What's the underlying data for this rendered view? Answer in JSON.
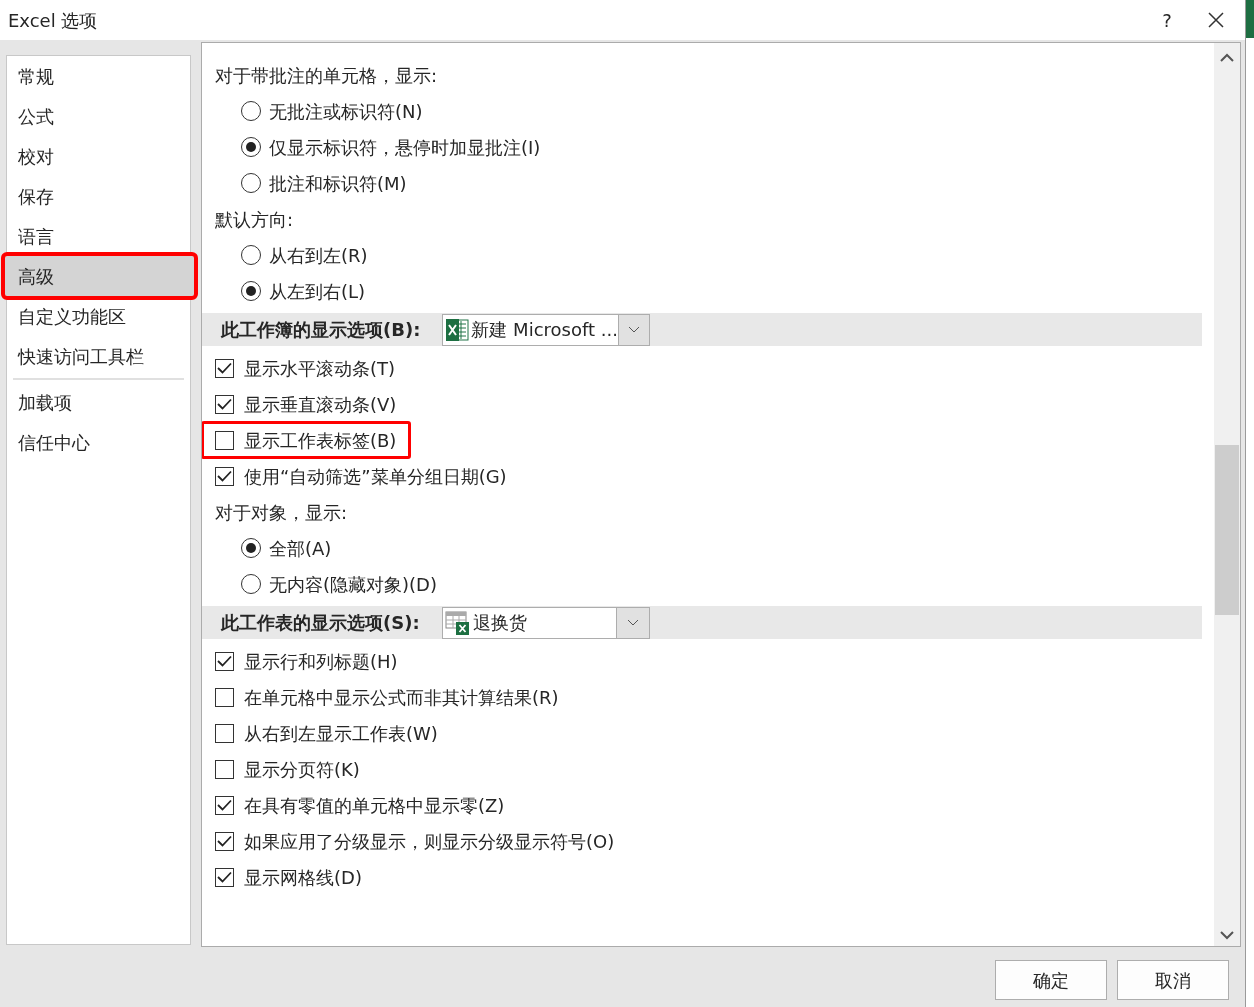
{
  "window": {
    "title": "Excel 选项",
    "help": "?"
  },
  "sidebar": {
    "groups": [
      [
        {
          "label": "常规",
          "selected": false,
          "highlighted": false
        },
        {
          "label": "公式",
          "selected": false,
          "highlighted": false
        },
        {
          "label": "校对",
          "selected": false,
          "highlighted": false
        },
        {
          "label": "保存",
          "selected": false,
          "highlighted": false
        },
        {
          "label": "语言",
          "selected": false,
          "highlighted": false
        },
        {
          "label": "高级",
          "selected": true,
          "highlighted": true
        },
        {
          "label": "自定义功能区",
          "selected": false,
          "highlighted": false
        },
        {
          "label": "快速访问工具栏",
          "selected": false,
          "highlighted": false
        }
      ],
      [
        {
          "label": "加载项",
          "selected": false,
          "highlighted": false
        },
        {
          "label": "信任中心",
          "selected": false,
          "highlighted": false
        }
      ]
    ]
  },
  "content": {
    "items": [
      {
        "kind": "label",
        "label": "对于带批注的单元格，显示:"
      },
      {
        "kind": "radio",
        "label": "无批注或标识符(N)",
        "selected": false
      },
      {
        "kind": "radio",
        "label": "仅显示标识符，悬停时加显批注(I)",
        "selected": true
      },
      {
        "kind": "radio",
        "label": "批注和标识符(M)",
        "selected": false
      },
      {
        "kind": "label",
        "label": "默认方向:"
      },
      {
        "kind": "radio",
        "label": "从右到左(R)",
        "selected": false
      },
      {
        "kind": "radio",
        "label": "从左到右(L)",
        "selected": true
      },
      {
        "kind": "section",
        "label": "此工作簿的显示选项(B):",
        "dropdown": {
          "value": "新建 Microsoft ..."
        }
      },
      {
        "kind": "checkbox",
        "label": "显示水平滚动条(T)",
        "checked": true,
        "highlighted": false
      },
      {
        "kind": "checkbox",
        "label": "显示垂直滚动条(V)",
        "checked": true,
        "highlighted": false
      },
      {
        "kind": "checkbox",
        "label": "显示工作表标签(B)",
        "checked": false,
        "highlighted": true
      },
      {
        "kind": "checkbox",
        "label": "使用“自动筛选”菜单分组日期(G)",
        "checked": true,
        "highlighted": false
      },
      {
        "kind": "label",
        "label": "对于对象，显示:"
      },
      {
        "kind": "radio",
        "label": "全部(A)",
        "selected": true
      },
      {
        "kind": "radio",
        "label": "无内容(隐藏对象)(D)",
        "selected": false
      },
      {
        "kind": "section",
        "label": "此工作表的显示选项(S):",
        "dropdown": {
          "value": "退换货"
        }
      },
      {
        "kind": "checkbox",
        "label": "显示行和列标题(H)",
        "checked": true,
        "highlighted": false
      },
      {
        "kind": "checkbox",
        "label": "在单元格中显示公式而非其计算结果(R)",
        "checked": false,
        "highlighted": false
      },
      {
        "kind": "checkbox",
        "label": "从右到左显示工作表(W)",
        "checked": false,
        "highlighted": false
      },
      {
        "kind": "checkbox",
        "label": "显示分页符(K)",
        "checked": false,
        "highlighted": false
      },
      {
        "kind": "checkbox",
        "label": "在具有零值的单元格中显示零(Z)",
        "checked": true,
        "highlighted": false
      },
      {
        "kind": "checkbox",
        "label": "如果应用了分级显示，则显示分级显示符号(O)",
        "checked": true,
        "highlighted": false
      },
      {
        "kind": "checkbox",
        "label": "显示网格线(D)",
        "checked": true,
        "highlighted": false
      }
    ]
  },
  "buttons": [
    {
      "label": "确定"
    },
    {
      "label": "取消"
    }
  ]
}
